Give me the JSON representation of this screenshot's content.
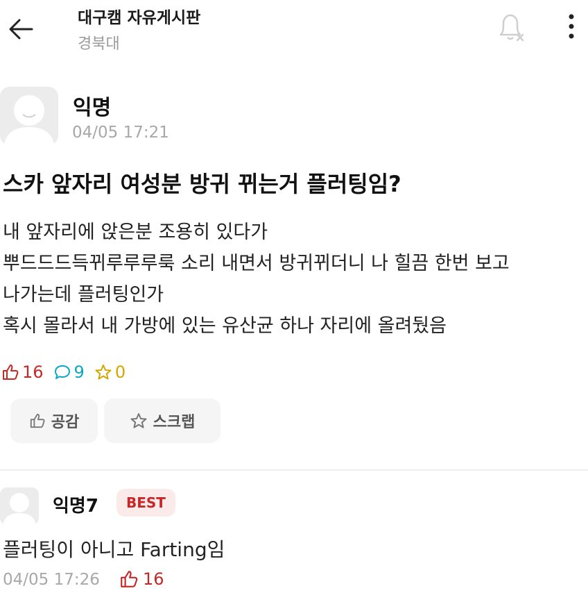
{
  "header": {
    "title": "대구캠 자유게시판",
    "subtitle": "경북대"
  },
  "post": {
    "author": "익명",
    "time": "04/05 17:21",
    "title": "스카 앞자리 여성분 방귀 뀌는거 플러팅임?",
    "body": [
      "내 앞자리에 앉은분 조용히 있다가",
      "뿌드드드득뀌루루루룩 소리 내면서 방귀뀌더니 나 힐끔 한번 보고",
      "나가는데 플러팅인가",
      "혹시 몰라서 내 가방에 있는 유산균 하나 자리에 올려뒀음"
    ],
    "stats": {
      "likes": "16",
      "comments": "9",
      "scraps": "0"
    },
    "buttons": {
      "like_label": "공감",
      "scrap_label": "스크랩"
    }
  },
  "comment": {
    "author": "익명7",
    "badge": "BEST",
    "body": "플러팅이 아니고 Farting임",
    "time": "04/05 17:26",
    "likes": "16"
  },
  "icons": {
    "back": "arrow-left-icon",
    "notifications": "bell-off-icon",
    "more": "more-vertical-icon",
    "like": "thumbs-up-icon",
    "comment": "comment-bubble-icon",
    "scrap": "star-icon"
  },
  "colors": {
    "like": "#c62828",
    "comment": "#0aa8c4",
    "scrap": "#d4a600",
    "best_bg": "#fbeaea"
  }
}
